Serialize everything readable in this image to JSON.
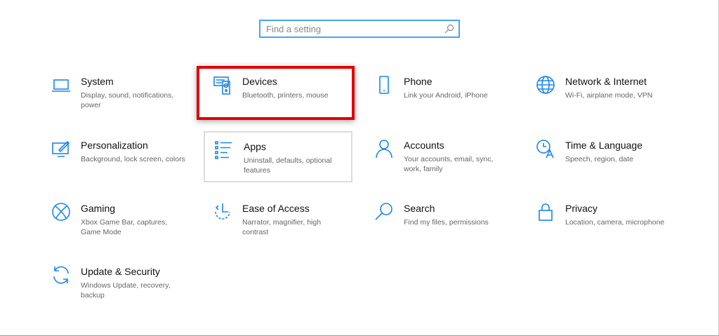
{
  "search": {
    "placeholder": "Find a setting",
    "icon": "search-icon"
  },
  "tiles": [
    {
      "title": "System",
      "desc": "Display, sound, notifications, power",
      "icon": "laptop-icon"
    },
    {
      "title": "Devices",
      "desc": "Bluetooth, printers, mouse",
      "icon": "devices-icon"
    },
    {
      "title": "Phone",
      "desc": "Link your Android, iPhone",
      "icon": "phone-icon"
    },
    {
      "title": "Network & Internet",
      "desc": "Wi-Fi, airplane mode, VPN",
      "icon": "globe-icon"
    },
    {
      "title": "Personalization",
      "desc": "Background, lock screen, colors",
      "icon": "paint-icon"
    },
    {
      "title": "Apps",
      "desc": "Uninstall, defaults, optional features",
      "icon": "apps-list-icon"
    },
    {
      "title": "Accounts",
      "desc": "Your accounts, email, sync, work, family",
      "icon": "person-icon"
    },
    {
      "title": "Time & Language",
      "desc": "Speech, region, date",
      "icon": "time-language-icon"
    },
    {
      "title": "Gaming",
      "desc": "Xbox Game Bar, captures, Game Mode",
      "icon": "xbox-icon"
    },
    {
      "title": "Ease of Access",
      "desc": "Narrator, magnifier, high contrast",
      "icon": "ease-of-access-icon"
    },
    {
      "title": "Search",
      "desc": "Find my files, permissions",
      "icon": "search-icon"
    },
    {
      "title": "Privacy",
      "desc": "Location, camera, microphone",
      "icon": "lock-icon"
    },
    {
      "title": "Update & Security",
      "desc": "Windows Update, recovery, backup",
      "icon": "refresh-icon"
    }
  ],
  "highlight_color": "#e00000",
  "accent": "#1a86ee"
}
